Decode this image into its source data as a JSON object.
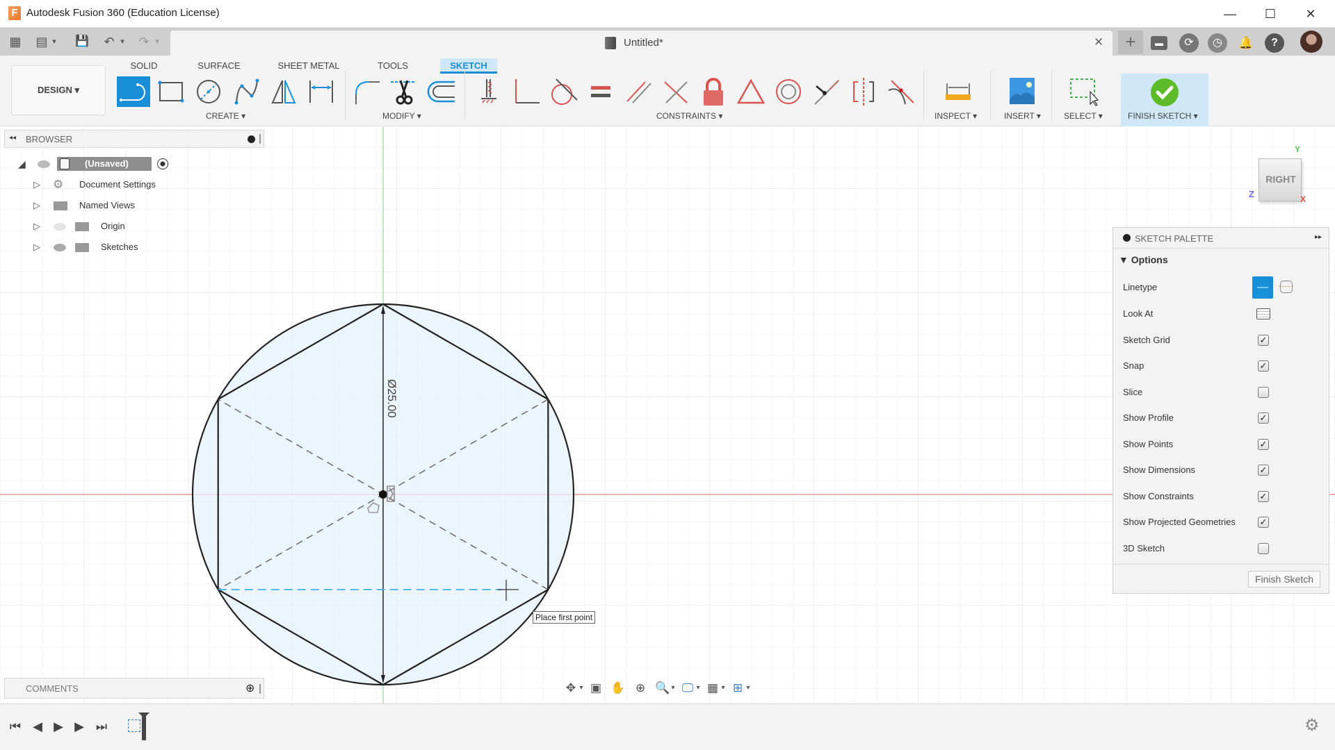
{
  "window": {
    "title": "Autodesk Fusion 360 (Education License)",
    "logo_letter": "F",
    "minimize": "—",
    "maximize": "☐",
    "close": "✕"
  },
  "quick_access": {
    "grid_icon": "▦",
    "file_icon": "▤",
    "save_icon": "💾",
    "undo_icon": "↶",
    "redo_icon": "↷",
    "dropdown": "▾"
  },
  "document_tab": {
    "title": "Untitled*",
    "close": "✕",
    "new_tab": "+"
  },
  "header_icons": [
    "chat-icon",
    "extensions-icon",
    "job-status-icon",
    "notifications-icon",
    "help-icon"
  ],
  "header_glyphs": {
    "chat": "▬",
    "extensions": "⟳",
    "job": "◷",
    "notify": "🔔",
    "help": "?"
  },
  "workspace": {
    "label": "DESIGN ▾"
  },
  "ribbon_tabs": [
    {
      "label": "SOLID",
      "active": false
    },
    {
      "label": "SURFACE",
      "active": false
    },
    {
      "label": "SHEET METAL",
      "active": false
    },
    {
      "label": "TOOLS",
      "active": false
    },
    {
      "label": "SKETCH",
      "active": true
    }
  ],
  "groups": {
    "create": "CREATE ▾",
    "modify": "MODIFY ▾",
    "constraints": "CONSTRAINTS ▾",
    "inspect": "INSPECT ▾",
    "insert": "INSERT ▾",
    "select": "SELECT ▾",
    "finish": "FINISH SKETCH ▾"
  },
  "browser": {
    "title": "BROWSER",
    "collapse_icon": "◂◂",
    "root": {
      "label": "(Unsaved)"
    },
    "items": [
      {
        "label": "Document Settings",
        "icon": "gear-icon",
        "visible": null
      },
      {
        "label": "Named Views",
        "icon": "folder-icon",
        "visible": null
      },
      {
        "label": "Origin",
        "icon": "folder-icon",
        "visible": false
      },
      {
        "label": "Sketches",
        "icon": "folder-icon",
        "visible": true
      }
    ]
  },
  "comments": {
    "title": "COMMENTS",
    "add_icon": "⊕"
  },
  "viewcube": {
    "face": "RIGHT",
    "axes": {
      "y": "Y",
      "z": "Z",
      "x": "X"
    },
    "colors": {
      "x": "#e8504d",
      "y": "#5cc65c",
      "z": "#6b6bf0"
    }
  },
  "sketch": {
    "dimension_label": "Ø25.00",
    "tooltip": "Place first point",
    "colors": {
      "profile_fill": "#e6f1fb",
      "line": "#222222",
      "construction": "#666666",
      "inference": "#3fb3e8",
      "x_axis": "#e06666",
      "y_axis": "#6cd46c",
      "grid": "#e6e6e6"
    }
  },
  "palette": {
    "title": "SKETCH PALETTE",
    "section": "▼ Options",
    "linetype_label": "Linetype",
    "look_at_label": "Look At",
    "options": [
      {
        "label": "Sketch Grid",
        "checked": true
      },
      {
        "label": "Snap",
        "checked": true
      },
      {
        "label": "Slice",
        "checked": false
      },
      {
        "label": "Show Profile",
        "checked": true
      },
      {
        "label": "Show Points",
        "checked": true
      },
      {
        "label": "Show Dimensions",
        "checked": true
      },
      {
        "label": "Show Constraints",
        "checked": true
      },
      {
        "label": "Show Projected Geometries",
        "checked": true
      },
      {
        "label": "3D Sketch",
        "checked": false
      }
    ],
    "finish_button": "Finish Sketch",
    "expand_icon": "▸▸"
  },
  "navbar": {
    "orbit": "✥",
    "look_at": "▣",
    "pan": "✋",
    "zoom": "⊕",
    "fit": "🔍",
    "display": "🖵",
    "grid": "▦",
    "viewports": "⊞",
    "dropdown": "▾"
  },
  "timeline": {
    "first": "⏮",
    "prev": "◀",
    "play": "▶",
    "next": "▶",
    "last": "⏭",
    "settings": "⚙"
  },
  "accent_colors": {
    "sketch_blue": "#1a8fd9",
    "finish_green": "#5dbb2a",
    "constraint_red": "#d9534f"
  }
}
